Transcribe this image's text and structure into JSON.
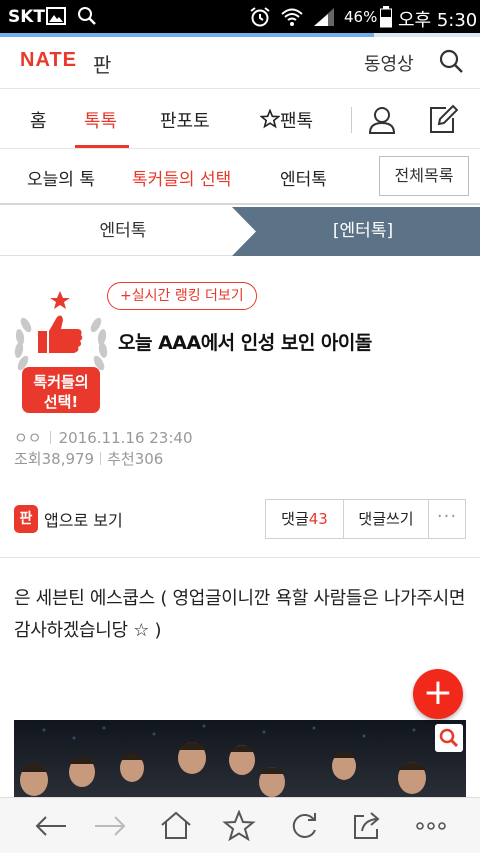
{
  "status": {
    "carrier": "SKT",
    "battery": "46%",
    "time": "오후 5:30"
  },
  "header": {
    "logo": "NATE",
    "logo_sub": "판",
    "video": "동영상"
  },
  "tabs": [
    {
      "label": "홈"
    },
    {
      "label": "톡톡"
    },
    {
      "label": "판포토"
    },
    {
      "label": "팬톡"
    }
  ],
  "subtabs": {
    "items": [
      "오늘의 톡",
      "톡커들의 선택",
      "엔터톡"
    ],
    "all_button": "전체목록"
  },
  "breadcrumb": {
    "left": "엔터톡",
    "right": "[엔터톡]"
  },
  "article": {
    "badge_text_line1": "톡커들의",
    "badge_text_line2": "선택!",
    "ranking_button": "+실시간 랭킹 더보기",
    "title": "오늘 AAA에서 인성 보인 아이돌",
    "author": "ㅇㅇ",
    "date": "2016.11.16 23:40",
    "views_label": "조회",
    "views": "38,979",
    "recommend_label": "추천",
    "recommend": "306",
    "app_icon_text": "판",
    "app_view": "앱으로 보기",
    "comments_label": "댓글",
    "comments_count": "43",
    "write_comment": "댓글쓰기",
    "more": "···",
    "body": "은 세븐틴 에스쿱스 ( 영업글이니깐 욕할 사람들은 나가주시면 감사하겠습니당 ☆ )"
  },
  "fab": {
    "label": "+"
  },
  "colors": {
    "brand": "#e8392c",
    "crumb_active": "#5b7287"
  }
}
